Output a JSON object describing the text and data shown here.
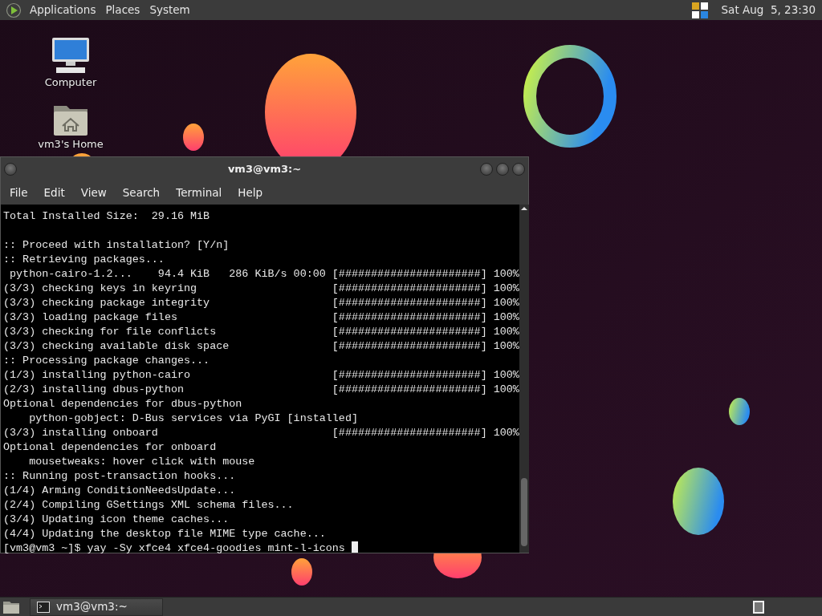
{
  "top_panel": {
    "menus": [
      "Applications",
      "Places",
      "System"
    ],
    "clock": "Sat Aug  5, 23:30"
  },
  "desktop_icons": [
    {
      "label": "Computer",
      "kind": "computer"
    },
    {
      "label": "vm3's Home",
      "kind": "home"
    }
  ],
  "terminal": {
    "title": "vm3@vm3:~",
    "menu": [
      "File",
      "Edit",
      "View",
      "Search",
      "Terminal",
      "Help"
    ],
    "blocks": [
      [
        {
          "text": "Total Installed Size:  29.16 MiB"
        }
      ],
      [
        {
          "text": ":: Proceed with installation? [Y/n]"
        },
        {
          "text": ":: Retrieving packages..."
        },
        {
          "text": " python-cairo-1.2...    94.4 KiB   286 KiB/s 00:00",
          "progress": "[######################] 100%"
        },
        {
          "text": "(3/3) checking keys in keyring",
          "progress": "[######################] 100%"
        },
        {
          "text": "(3/3) checking package integrity",
          "progress": "[######################] 100%"
        },
        {
          "text": "(3/3) loading package files",
          "progress": "[######################] 100%"
        },
        {
          "text": "(3/3) checking for file conflicts",
          "progress": "[######################] 100%"
        },
        {
          "text": "(3/3) checking available disk space",
          "progress": "[######################] 100%"
        },
        {
          "text": ":: Processing package changes..."
        },
        {
          "text": "(1/3) installing python-cairo",
          "progress": "[######################] 100%"
        },
        {
          "text": "(2/3) installing dbus-python",
          "progress": "[######################] 100%"
        },
        {
          "text": "Optional dependencies for dbus-python"
        },
        {
          "text": "    python-gobject: D-Bus services via PyGI [installed]"
        },
        {
          "text": "(3/3) installing onboard",
          "progress": "[######################] 100%"
        },
        {
          "text": "Optional dependencies for onboard"
        },
        {
          "text": "    mousetweaks: hover click with mouse"
        },
        {
          "text": ":: Running post-transaction hooks..."
        },
        {
          "text": "(1/4) Arming ConditionNeedsUpdate..."
        },
        {
          "text": "(2/4) Compiling GSettings XML schema files..."
        },
        {
          "text": "(3/4) Updating icon theme caches..."
        },
        {
          "text": "(4/4) Updating the desktop file MIME type cache..."
        }
      ]
    ],
    "prompt": "[vm3@vm3 ~]$ yay -Sy xfce4 xfce4-goodies mint-l-icons"
  },
  "taskbar": {
    "tasks": [
      {
        "label": "vm3@vm3:~"
      }
    ]
  }
}
